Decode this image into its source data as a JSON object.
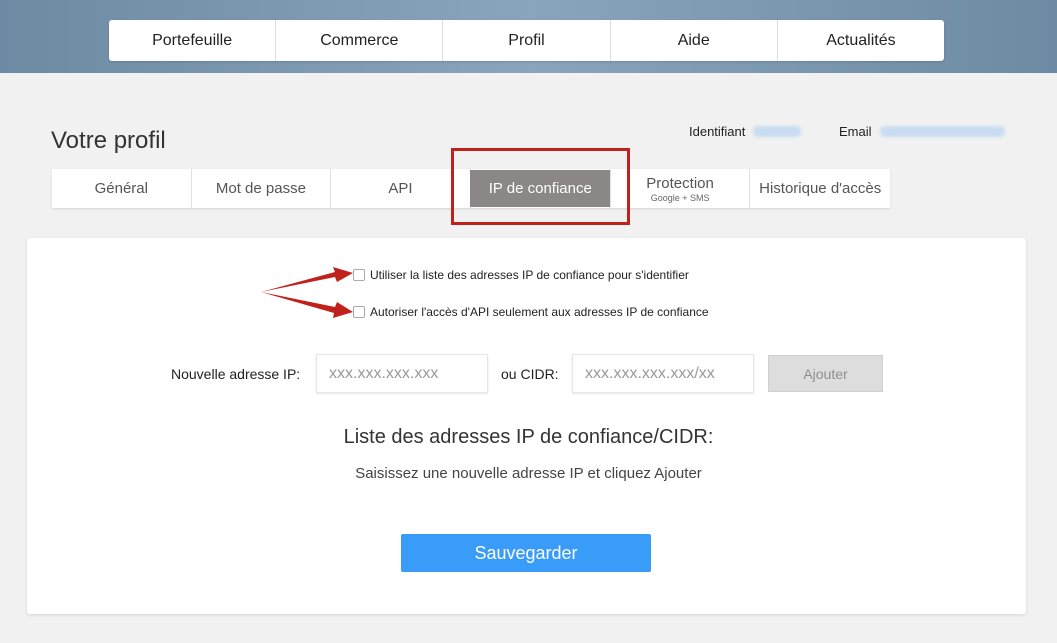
{
  "top_nav": {
    "items": [
      {
        "label": "Portefeuille"
      },
      {
        "label": "Commerce"
      },
      {
        "label": "Profil"
      },
      {
        "label": "Aide"
      },
      {
        "label": "Actualités"
      }
    ]
  },
  "page": {
    "title": "Votre profil",
    "identifier_label": "Identifiant",
    "email_label": "Email"
  },
  "subtabs": [
    {
      "label": "Général"
    },
    {
      "label": "Mot de passe"
    },
    {
      "label": "API"
    },
    {
      "label": "IP de confiance",
      "active": true
    },
    {
      "label": "Protection",
      "sub": "Google + SMS"
    },
    {
      "label": "Historique d'accès"
    }
  ],
  "options": {
    "use_trusted_ip_login": "Utiliser la liste des adresses IP de confiance pour s'identifier",
    "api_only_trusted_ip": "Autoriser l'accès d'API seulement aux adresses IP de confiance"
  },
  "form": {
    "new_ip_label": "Nouvelle adresse IP:",
    "new_ip_placeholder": "xxx.xxx.xxx.xxx",
    "cidr_label": "ou CIDR:",
    "cidr_placeholder": "xxx.xxx.xxx.xxx/xx",
    "add_button": "Ajouter"
  },
  "list": {
    "title": "Liste des adresses IP de confiance/CIDR:",
    "empty_hint": "Saisissez une nouvelle adresse IP et cliquez Ajouter"
  },
  "actions": {
    "save_button": "Sauvegarder"
  },
  "colors": {
    "accent": "#3a9cf9",
    "active_tab": "#8c8787",
    "annotation": "#c0211b"
  }
}
